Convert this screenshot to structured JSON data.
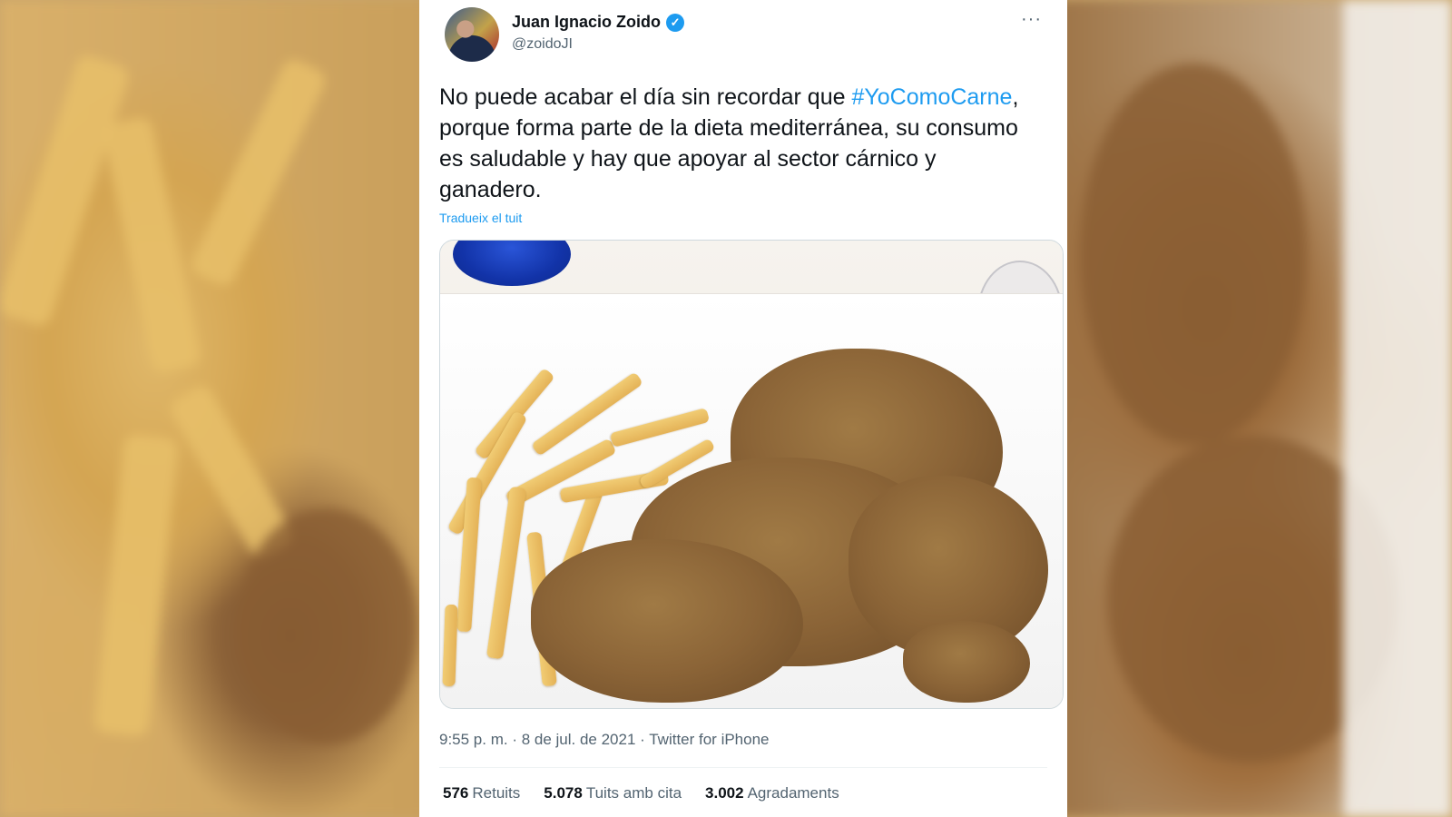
{
  "tweet": {
    "author_name": "Juan Ignacio Zoido",
    "author_handle": "@zoidoJI",
    "verified_icon": "verified-check-icon",
    "more_label": "···",
    "text_before": "No puede acabar el día sin recordar que ",
    "hashtag": "#YoComoCarne",
    "text_after": ", porque forma parte de la dieta mediterránea, su consumo es saludable y hay que apoyar al sector cárnico y ganadero.",
    "translate_label": "Tradueix el tuit",
    "timestamp": "9:55 p. m. · 8 de jul. de 2021 · Twitter for iPhone",
    "stats": {
      "retweets_count": "576",
      "retweets_label": "Retuits",
      "quotes_count": "5.078",
      "quotes_label": "Tuits amb cita",
      "likes_count": "3.002",
      "likes_label": "Agradaments"
    }
  },
  "colors": {
    "link": "#1d9bf0",
    "text": "#0f1419",
    "secondary": "#536471"
  }
}
